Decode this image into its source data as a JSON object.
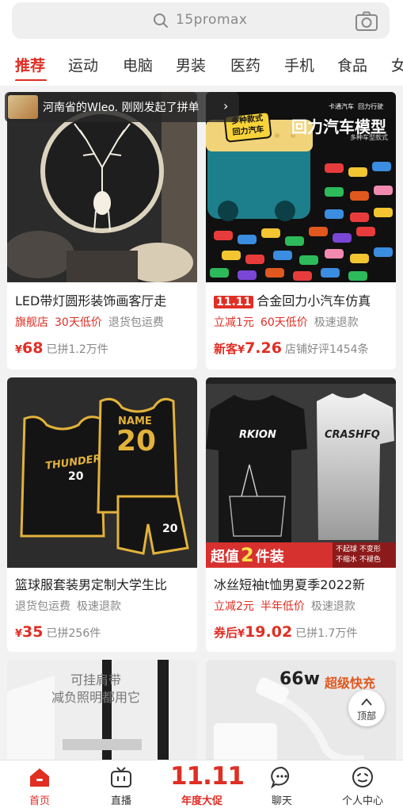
{
  "search": {
    "value": "15promax"
  },
  "tabs": [
    "推荐",
    "运动",
    "电脑",
    "男装",
    "医药",
    "手机",
    "食品",
    "女"
  ],
  "toast": {
    "text": "河南省的Wleo. 刚刚发起了拼单"
  },
  "products": [
    {
      "title": "LED带灯圆形装饰画客厅走",
      "tags": [
        "旗舰店",
        "30天低价",
        "退货包运费"
      ],
      "price_symbol": "¥",
      "price": "68",
      "sold": "已拼1.2万件"
    },
    {
      "badge": "11.11",
      "title": "合金回力小汽车仿真",
      "tags": [
        "立减1元",
        "60天低价",
        "极速退款"
      ],
      "price_prefix": "新客",
      "price_symbol": "¥",
      "price": "7.26",
      "sold": "店铺好评1454条",
      "image_text": {
        "banner": "回力汽车模型",
        "sub": "多种车型款式",
        "bubble_a": "多种款式",
        "bubble_b": "回力汽车",
        "top_a": "卡通汽车",
        "top_b": "回力行驶"
      }
    },
    {
      "title": "篮球服套装男定制大学生比",
      "tags": [
        "退货包运费",
        "极速退款"
      ],
      "price_symbol": "¥",
      "price": "35",
      "sold": "已拼256件",
      "image_text": {
        "team": "THUNDER",
        "name": "NAME",
        "number": "20"
      }
    },
    {
      "title": "冰丝短袖t恤男夏季2022新",
      "tags": [
        "立减2元",
        "半年低价",
        "极速退款"
      ],
      "price_prefix": "券后",
      "price_symbol": "¥",
      "price": "19.02",
      "sold": "已拼1.7万件",
      "image_text": {
        "shirt_a": "RKION",
        "shirt_b": "CRASHFQ",
        "banner_a": "超值",
        "banner_num": "2",
        "banner_b": "件装",
        "f1": "不起球",
        "f2": "不变形",
        "f3": "不缩水",
        "f4": "不褪色"
      }
    },
    {
      "image_text": {
        "line1": "可挂肩带",
        "line2": "减负照明都用它"
      }
    },
    {
      "image_text": {
        "watt": "66w",
        "fast": "超级快充"
      }
    }
  ],
  "back_to_top": "顶部",
  "bottom_nav": [
    {
      "label": "首页",
      "icon": "home-icon"
    },
    {
      "label": "直播",
      "icon": "tv-icon"
    },
    {
      "label": "年度大促",
      "big": "11.11",
      "icon": "promo-1111"
    },
    {
      "label": "聊天",
      "icon": "chat-icon"
    },
    {
      "label": "个人中心",
      "icon": "profile-icon"
    }
  ],
  "colors": {
    "accent": "#e02e24"
  }
}
